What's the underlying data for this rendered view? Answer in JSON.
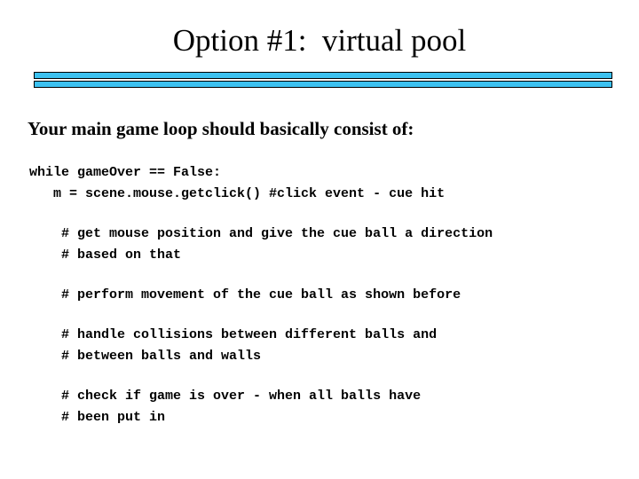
{
  "slide": {
    "title": "Option #1:  virtual pool",
    "lead_text": "Your main game loop should basically consist of:",
    "accent_color": "#3cc1f0",
    "text_color": "#000000",
    "background_color": "#ffffff",
    "rule_count": 2,
    "code_groups": [
      {
        "lines": [
          "while gameOver == False:",
          "   m = scene.mouse.getclick() #click event - cue hit"
        ]
      },
      {
        "lines": [
          "    # get mouse position and give the cue ball a direction",
          "    # based on that"
        ]
      },
      {
        "lines": [
          "    # perform movement of the cue ball as shown before"
        ]
      },
      {
        "lines": [
          "    # handle collisions between different balls and",
          "    # between balls and walls"
        ]
      },
      {
        "lines": [
          "    # check if game is over - when all balls have",
          "    # been put in"
        ]
      }
    ]
  }
}
